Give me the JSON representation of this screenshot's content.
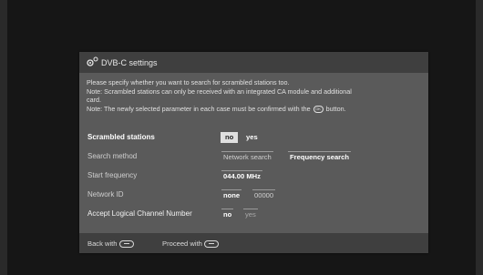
{
  "dialog": {
    "title": "DVB-C settings",
    "info": {
      "line1": "Please specify whether you want to search for scrambled stations too.",
      "line2": "Note: Scrambled stations can only be received with an integrated CA module and additional",
      "line3": "card.",
      "line4_prefix": "Note: The newly selected parameter in each case must be confirmed with the",
      "ok_key": "OK",
      "line4_suffix": "button."
    },
    "rows": {
      "scrambled": {
        "label": "Scrambled stations",
        "opt1": "no",
        "opt2": "yes"
      },
      "search_method": {
        "label": "Search method",
        "opt1": "Network search",
        "opt2": "Frequency search"
      },
      "start_frequency": {
        "label": "Start frequency",
        "value": "044.00 MHz"
      },
      "network_id": {
        "label": "Network ID",
        "opt1": "none",
        "opt2": "00000"
      },
      "lcn": {
        "label": "Accept Logical Channel Number",
        "opt1": "no",
        "opt2": "yes"
      }
    },
    "footer": {
      "back": "Back with",
      "proceed": "Proceed with"
    }
  },
  "colors": {
    "dialog_bg": "#5a5a5a",
    "bar_bg": "#3f3f3f",
    "highlight": "#e0e0e0"
  }
}
